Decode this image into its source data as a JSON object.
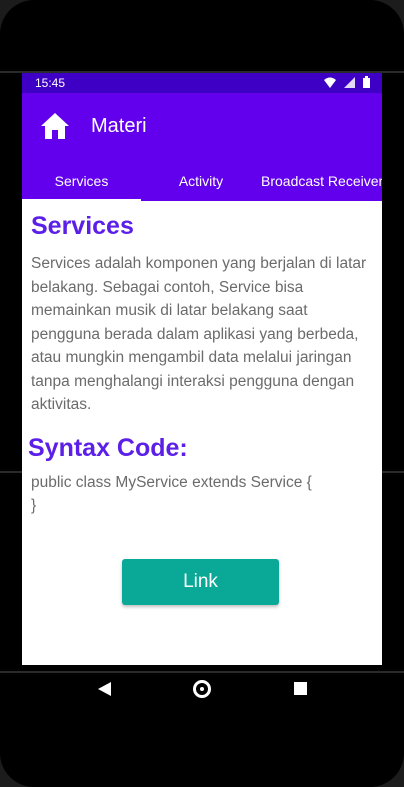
{
  "status_bar": {
    "time": "15:45",
    "icons": [
      "wifi-icon",
      "signal-icon",
      "battery-icon"
    ]
  },
  "app_bar": {
    "title": "Materi",
    "icon": "home-icon",
    "color": "#6200ee"
  },
  "tabs": [
    {
      "label": "Services",
      "selected": true
    },
    {
      "label": "Activity",
      "selected": false
    },
    {
      "label": "Broadcast Receiver",
      "selected": false
    }
  ],
  "content": {
    "heading": "Services",
    "description": "Services adalah komponen yang berjalan di latar belakang. Sebagai contoh, Service bisa memainkan musik di latar belakang saat pengguna berada dalam aplikasi yang berbeda, atau mungkin mengambil data melalui jaringan tanpa menghalangi interaksi pengguna dengan aktivitas.",
    "syntax_heading": "Syntax Code:",
    "code_lines": [
      "public class MyService extends Service {",
      "}"
    ],
    "link_label": "Link",
    "heading_color": "#5b1fe8",
    "button_color": "#0aa896"
  },
  "nav_bar": {
    "icons": [
      "back-icon",
      "home-circle-icon",
      "recents-icon"
    ]
  }
}
